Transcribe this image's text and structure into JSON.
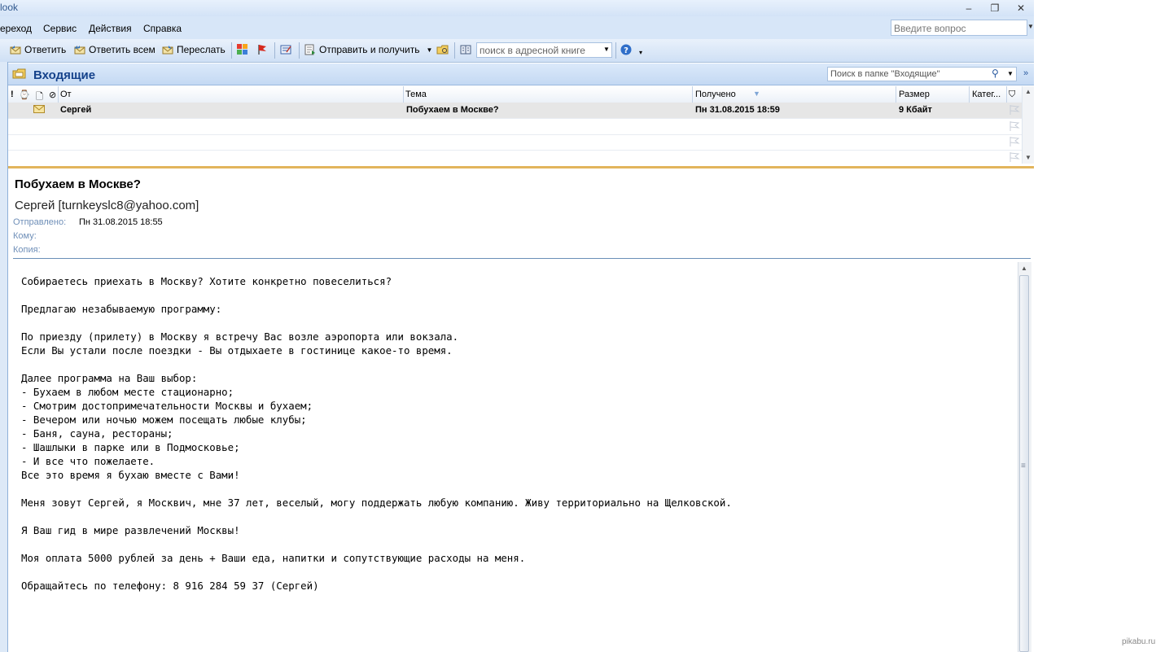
{
  "window": {
    "title": "look"
  },
  "menu": {
    "items": [
      "ереход",
      "Сервис",
      "Действия",
      "Справка"
    ]
  },
  "ask": {
    "placeholder": "Введите вопрос"
  },
  "toolbar": {
    "reply": "Ответить",
    "reply_all": "Ответить всем",
    "forward": "Переслать",
    "send_receive": "Отправить и получить",
    "address_search": "поиск в адресной книге"
  },
  "folder": {
    "title": "Входящие",
    "search_placeholder": "Поиск в папке \"Входящие\""
  },
  "columns": {
    "from": "От",
    "subject": "Тема",
    "received": "Получено",
    "size": "Размер",
    "category": "Катег..."
  },
  "messages": [
    {
      "from": "Сергей",
      "subject": "Побухаем в Москве?",
      "received": "Пн 31.08.2015 18:59",
      "size": "9 Кбайт"
    }
  ],
  "reading": {
    "subject": "Побухаем в Москве?",
    "sender": "Сергей [turnkeyslc8@yahoo.com]",
    "sent_label": "Отправлено:",
    "sent_value": "Пн 31.08.2015 18:55",
    "to_label": "Кому:",
    "cc_label": "Копия:",
    "body": [
      "Собираетесь приехать в Москву? Хотите конкретно повеселиться?",
      "",
      "Предлагаю незабываемую программу:",
      "",
      "По приезду (прилету) в Москву я встречу Вас возле аэропорта или вокзала.",
      "Если Вы устали после поездки - Вы отдыхаете в гостинице какое-то время.",
      "",
      "Далее программа на Ваш выбор:",
      "- Бухаем в любом месте стационарно;",
      "- Смотрим достопримечательности Москвы и бухаем;",
      "- Вечером или ночью можем посещать любые клубы;",
      "- Баня, сауна, рестораны;",
      "- Шашлыки в парке или в Подмосковье;",
      "- И все что пожелаете.",
      "Все это время я бухаю вместе с Вами!",
      "",
      "Меня зовут Сергей, я Москвич, мне 37 лет, веселый, могу поддержать любую компанию. Живу территориально на Щелковской.",
      "",
      "Я Ваш гид в мире развлечений Москвы!",
      "",
      "Моя оплата 5000 рублей за день + Ваши еда, напитки и сопутствующие расходы на меня.",
      "",
      "Обращайтесь по телефону: 8 916 284 59 37 (Сергей)"
    ]
  },
  "watermark": "pikabu.ru",
  "colors": {
    "accent": "#15428b",
    "header_bg": "#c4d9f3",
    "splitter": "#e2b55c"
  }
}
